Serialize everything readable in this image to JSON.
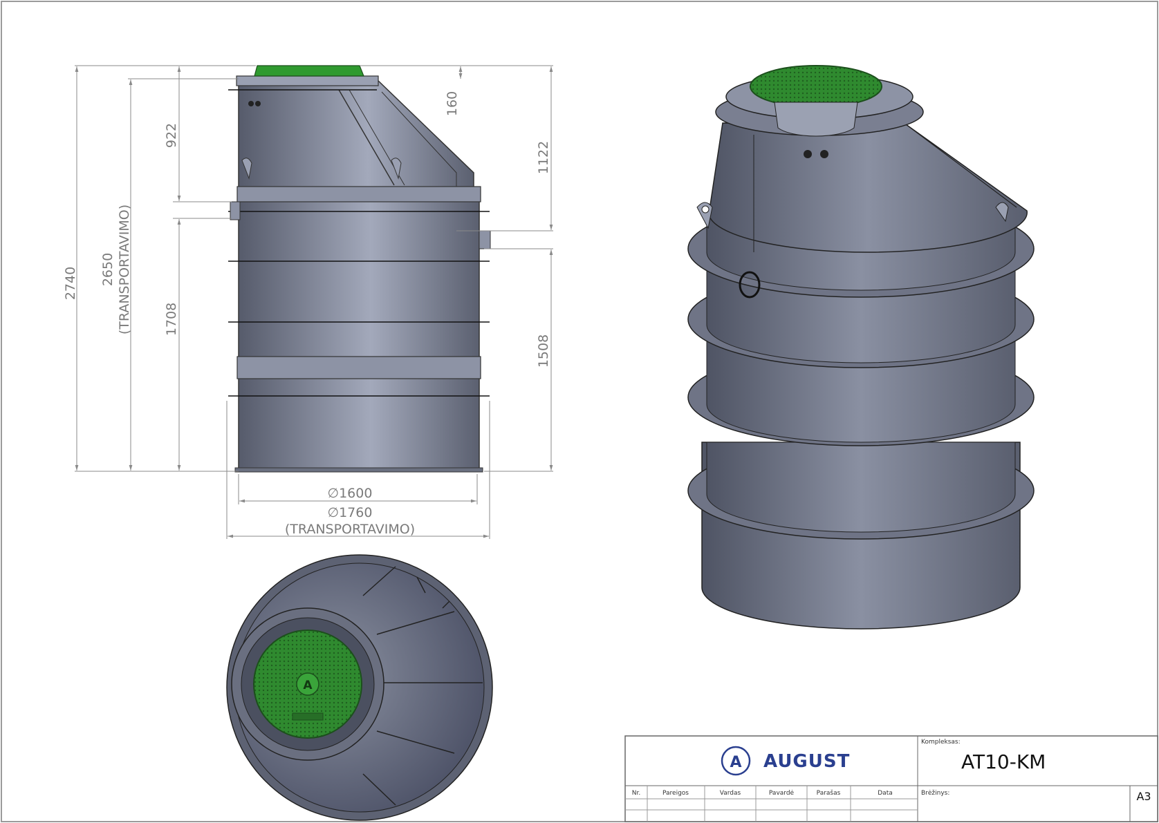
{
  "dimensions": {
    "overall_height": "2740",
    "transport_height": "2650",
    "transport_label": "(TRANSPORTAVIMO)",
    "upper_section": "922",
    "lower_section": "1708",
    "lid_offset": "160",
    "outlet_height_top": "1122",
    "outlet_height_bottom": "1508",
    "diameter_inner": "1600",
    "diameter_outer": "1760",
    "diameter_symbol": "∅"
  },
  "title_block": {
    "logo_letter": "A",
    "brand_name": "AUGUST",
    "kompleksas_label": "Kompleksas:",
    "kompleksas_value": "AT10-KM",
    "brezinys_label": "Brėžinys:",
    "sheet_size": "A3",
    "columns": [
      "Nr.",
      "Pareigos",
      "Vardas",
      "Pavardė",
      "Parašas",
      "Data"
    ]
  },
  "colors": {
    "tank_body": "#7d8396",
    "tank_dark": "#4e5363",
    "tank_light": "#aab0c2",
    "lid_green": "#2f8f2f",
    "dimension_line": "#8a8a8a",
    "brand_blue": "#2a3f8f"
  }
}
